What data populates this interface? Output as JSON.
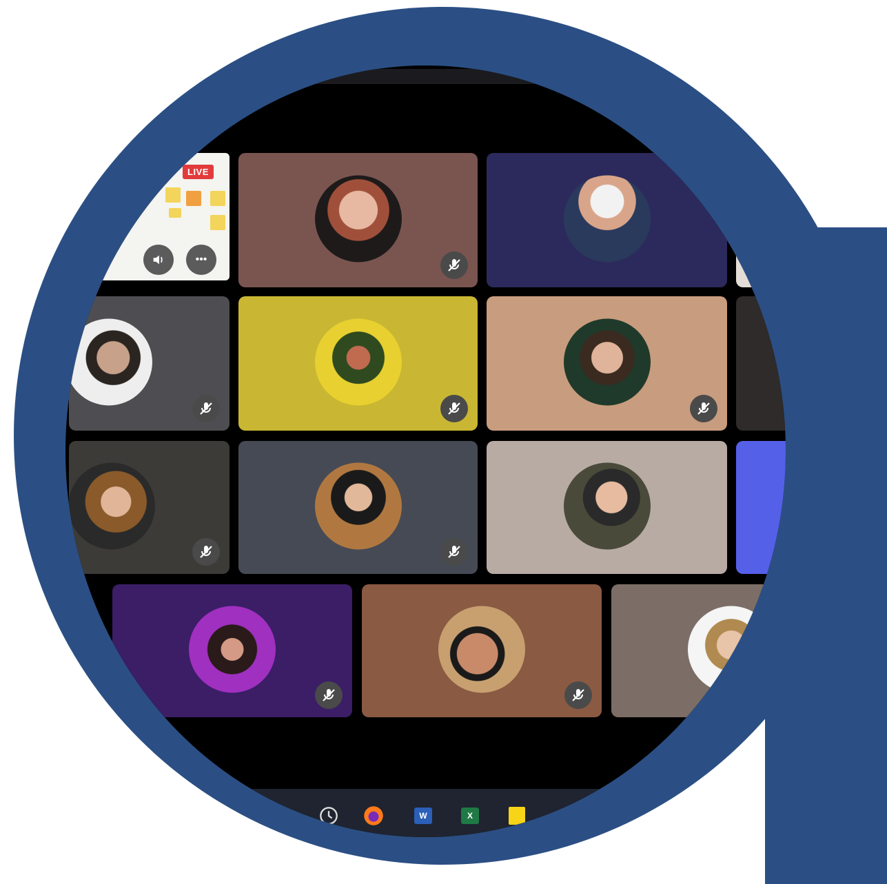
{
  "app": {
    "live_badge": "LIVE",
    "participant_count": 15
  },
  "screen_share": {
    "volume_button": "volume-icon",
    "more_button": "more-options-icon"
  },
  "participants": [
    {
      "id": "p1",
      "bg": "#7a5550",
      "muted": true
    },
    {
      "id": "p2",
      "bg": "#2c2a5c",
      "muted": false
    },
    {
      "id": "p3",
      "bg": "#e4ddd7",
      "muted": false
    },
    {
      "id": "p4",
      "bg": "#4e4e52",
      "muted": true
    },
    {
      "id": "p5",
      "bg": "#c9b733",
      "muted": true
    },
    {
      "id": "p6",
      "bg": "#c89c7e",
      "muted": true
    },
    {
      "id": "p7",
      "bg": "#2e2b2a",
      "muted": false
    },
    {
      "id": "p8",
      "bg": "#3c3b38",
      "muted": true
    },
    {
      "id": "p9",
      "bg": "#464a55",
      "muted": true
    },
    {
      "id": "p10",
      "bg": "#b7aba3",
      "muted": false
    },
    {
      "id": "p11",
      "bg": "#5560e8",
      "muted": false
    },
    {
      "id": "p12",
      "bg": "#3b1e66",
      "muted": true
    },
    {
      "id": "p13",
      "bg": "#8a5a43",
      "muted": true
    },
    {
      "id": "p14",
      "bg": "#7c6e66",
      "muted": false
    }
  ],
  "taskbar": {
    "icons": [
      "clock-icon",
      "firefox-icon",
      "word-icon",
      "excel-icon",
      "sticky-notes-icon"
    ],
    "word_label": "W",
    "excel_label": "X"
  },
  "colors": {
    "frame": "#2b4f84",
    "background": "#000000",
    "mute_badge": "#4a4a4a",
    "live": "#e23b3b"
  }
}
